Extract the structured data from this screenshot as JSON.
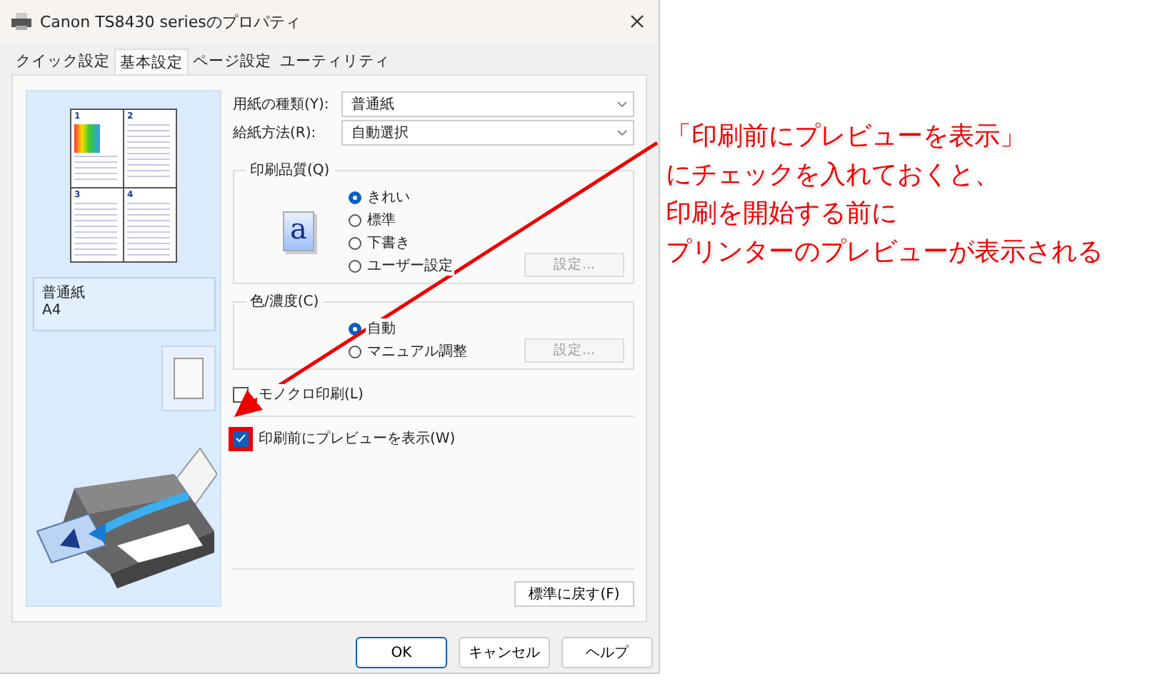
{
  "window": {
    "title": "Canon TS8430 seriesのプロパティ"
  },
  "tabs": [
    {
      "label": "クイック設定",
      "selected": false
    },
    {
      "label": "基本設定",
      "selected": true
    },
    {
      "label": "ページ設定",
      "selected": false
    },
    {
      "label": "ユーティリティ",
      "selected": false
    }
  ],
  "preview": {
    "pages": [
      "1",
      "2",
      "3",
      "4"
    ],
    "media": "普通紙",
    "size": "A4"
  },
  "fields": [
    {
      "label": "用紙の種類(Y):",
      "value": "普通紙"
    },
    {
      "label": "給紙方法(R):",
      "value": "自動選択"
    }
  ],
  "groups": [
    {
      "title": "印刷品質(Q)",
      "icon_letter": "a",
      "options": [
        {
          "label": "きれい",
          "selected": true
        },
        {
          "label": "標準",
          "selected": false
        },
        {
          "label": "下書き",
          "selected": false
        },
        {
          "label": "ユーザー設定",
          "selected": false
        }
      ],
      "button": {
        "label": "設定...",
        "disabled": true
      }
    },
    {
      "title": "色/濃度(C)",
      "options": [
        {
          "label": "自動",
          "selected": true
        },
        {
          "label": "マニュアル調整",
          "selected": false
        }
      ],
      "button": {
        "label": "設定...",
        "disabled": true
      }
    }
  ],
  "checkboxes": [
    {
      "label": "モノクロ印刷(L)",
      "checked": false,
      "highlighted": false
    },
    {
      "label": "印刷前にプレビューを表示(W)",
      "checked": true,
      "highlighted": true
    }
  ],
  "reset_button": "標準に戻す(F)",
  "buttons": [
    {
      "label": "OK",
      "default": true
    },
    {
      "label": "キャンセル",
      "default": false
    },
    {
      "label": "ヘルプ",
      "default": false
    }
  ],
  "annotation": [
    "「印刷前にプレビューを表示」",
    "にチェックを入れておくと、",
    "印刷を開始する前に",
    "プリンターのプレビューが表示される"
  ]
}
